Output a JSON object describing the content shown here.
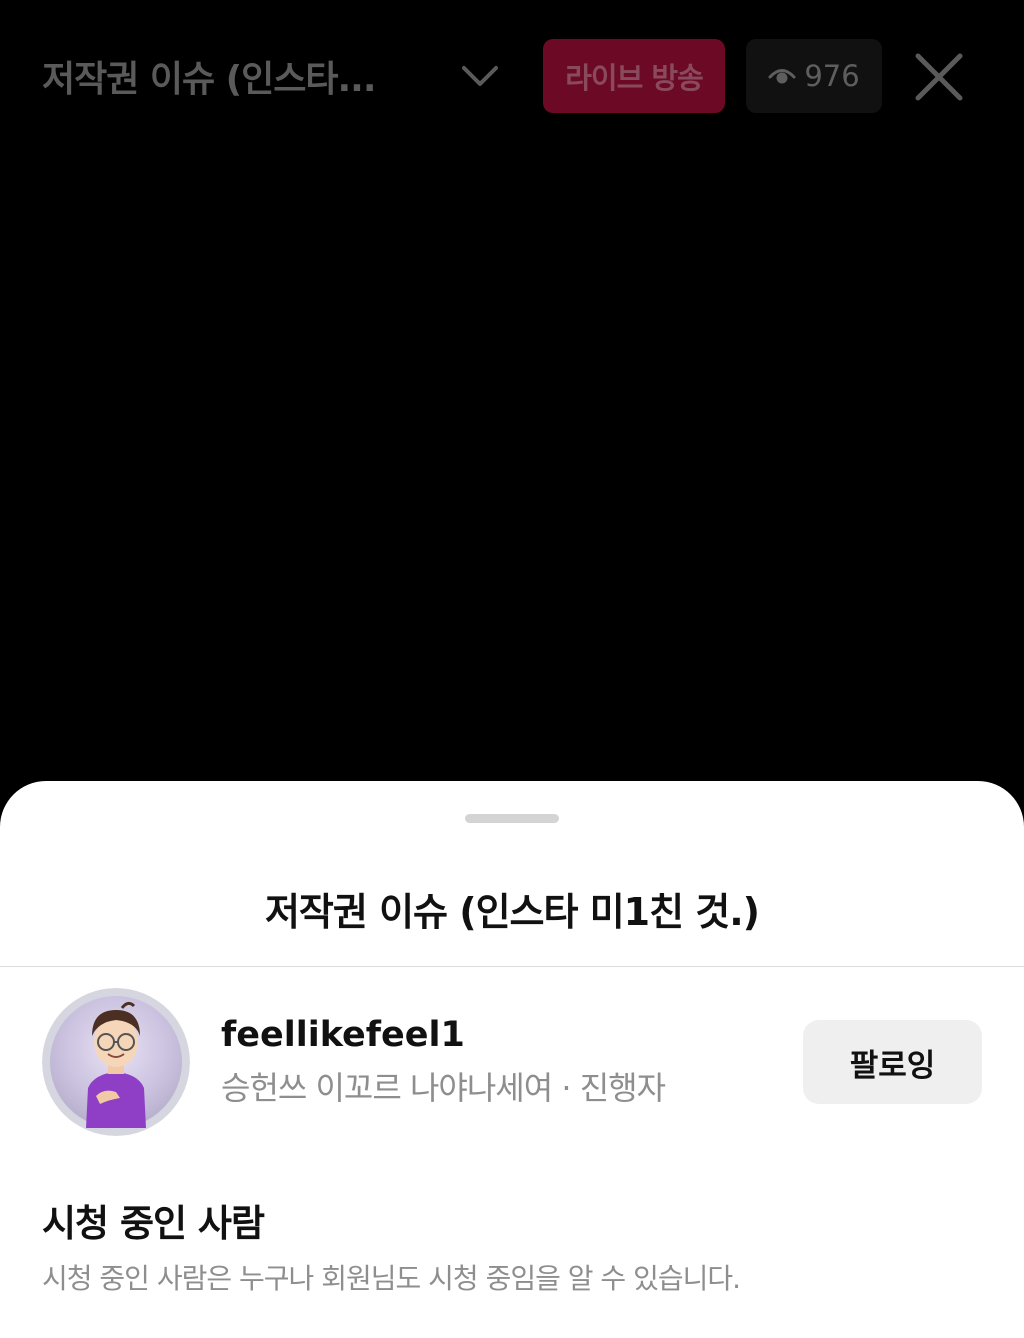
{
  "header": {
    "title_truncated": "저작권 이슈 (인스타...",
    "live_badge_label": "라이브 방송",
    "viewer_count": "976",
    "icons": {
      "dropdown": "chevron-down-icon",
      "viewers": "eye-icon",
      "close": "close-icon"
    }
  },
  "sheet": {
    "title": "저작권 이슈 (인스타 미1친 것.)",
    "host": {
      "username": "feellikefeel1",
      "subtitle": "승헌쓰 이꼬르 나야나세여 · 진행자",
      "follow_label": "팔로잉"
    },
    "viewers_section": {
      "heading": "시청 중인 사람",
      "description": "시청 중인 사람은 누구나 회원님도 시청 중임을 알 수 있습니다."
    }
  },
  "colors": {
    "live_badge": "#6c0a26",
    "follow_button": "#efefef",
    "avatar_shirt": "#8e3fc6"
  }
}
